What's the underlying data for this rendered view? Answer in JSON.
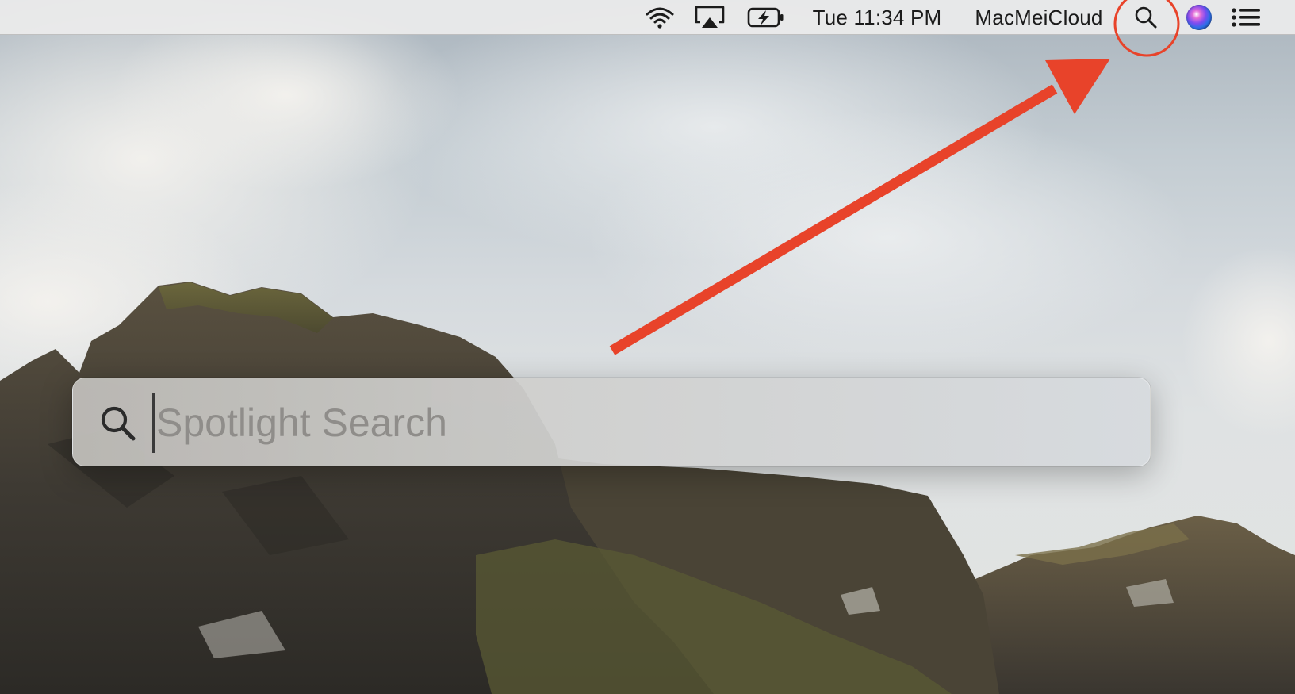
{
  "menubar": {
    "wifi_icon": "wifi-icon",
    "airplay_icon": "airplay-icon",
    "battery_icon": "battery-charging-icon",
    "clock": "Tue 11:34 PM",
    "user": "MacMeiCloud",
    "search_icon": "search-icon",
    "siri_icon": "siri-icon",
    "notification_icon": "notification-center-icon"
  },
  "spotlight": {
    "placeholder": "Spotlight Search",
    "value": "",
    "icon": "search-icon"
  },
  "annotation": {
    "color": "#e8432a"
  }
}
